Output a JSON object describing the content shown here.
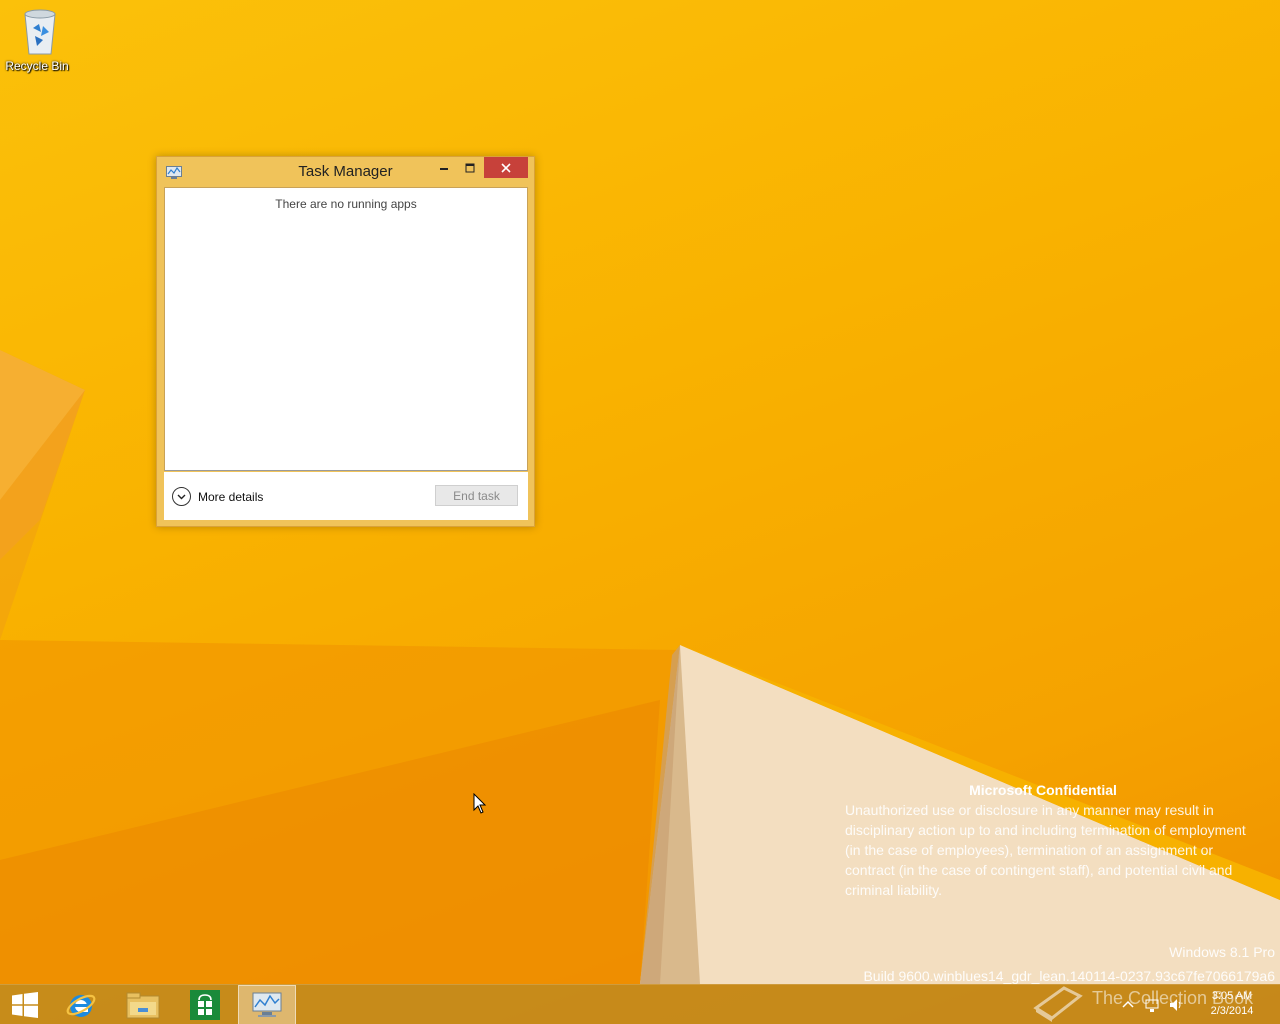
{
  "desktop": {
    "icons": [
      {
        "label": "Recycle Bin"
      }
    ]
  },
  "task_manager": {
    "title": "Task Manager",
    "empty_message": "There are no running apps",
    "more_details_label": "More details",
    "end_task_label": "End task",
    "end_task_enabled": false,
    "window_buttons": [
      "minimize-icon",
      "maximize-icon",
      "close-icon"
    ]
  },
  "watermark": {
    "heading": "Microsoft Confidential",
    "body": "Unauthorized use or disclosure in any manner may result in disciplinary action up to and including termination of employment (in the case of employees), termination of an assignment or contract (in the case of contingent staff), and potential civil and criminal liability.",
    "edition": "Windows 8.1 Pro",
    "build": "Build 9600.winblues14_gdr_lean.140114-0237.93c67fe7066179a6"
  },
  "overlay_logo": {
    "text": "The Collection Book"
  },
  "taskbar": {
    "items": [
      {
        "name": "start-button",
        "icon": "windows-logo-icon"
      },
      {
        "name": "internet-explorer",
        "icon": "internet-explorer-icon"
      },
      {
        "name": "file-explorer",
        "icon": "folder-icon"
      },
      {
        "name": "store",
        "icon": "store-icon"
      },
      {
        "name": "task-manager",
        "icon": "task-manager-icon",
        "active": true
      }
    ],
    "clock": {
      "time": "3:05 AM",
      "date": "2/3/2014"
    },
    "tray_icons": [
      "show-hidden-icons-icon",
      "network-icon",
      "volume-icon"
    ]
  },
  "colors": {
    "wallpaper": "#f8b400",
    "window_frame": "#f0c35a",
    "close_button": "#c7413a",
    "taskbar": "#be871e"
  }
}
